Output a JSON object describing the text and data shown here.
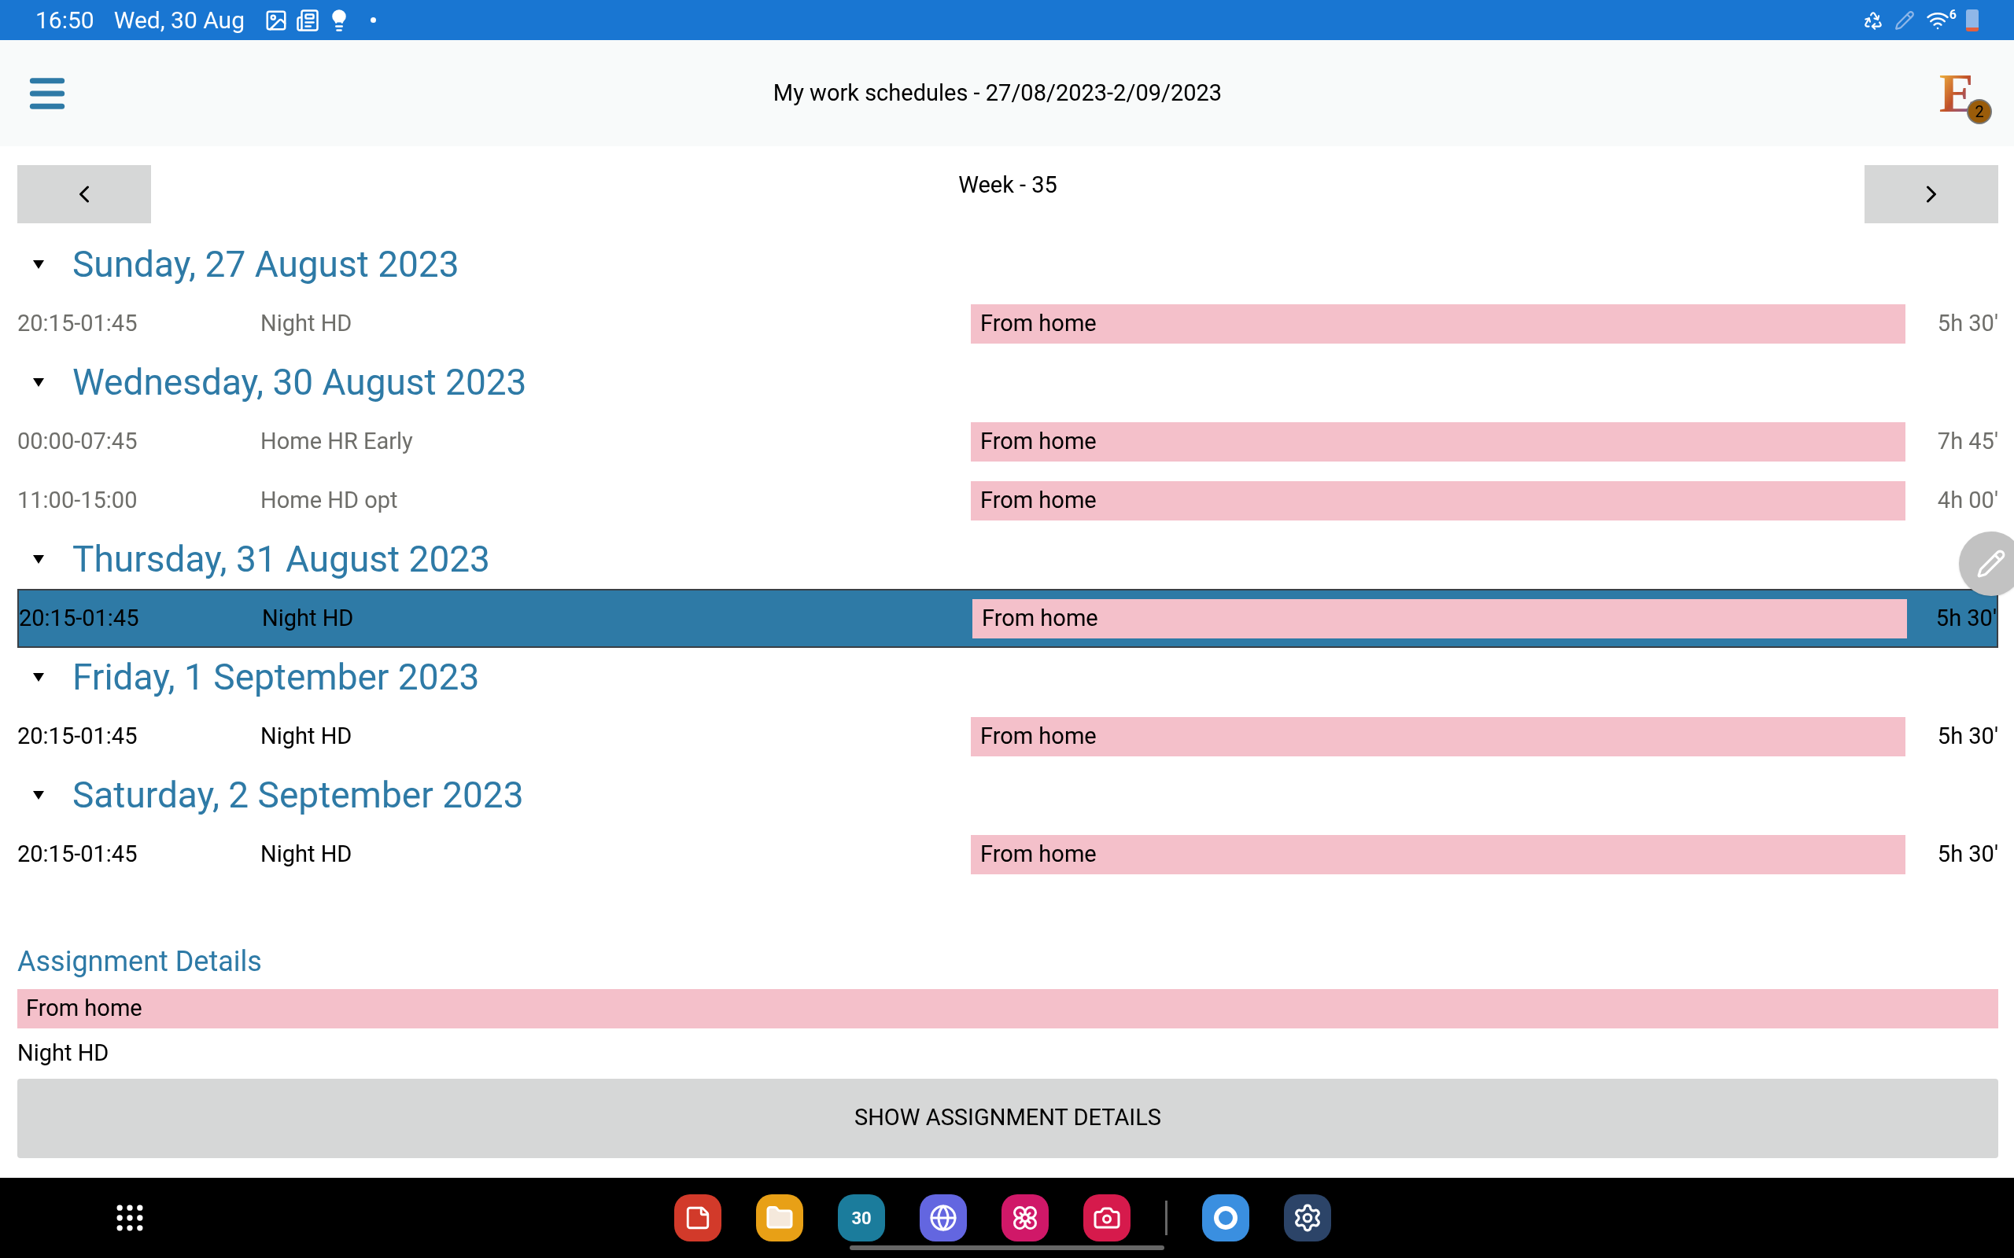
{
  "status_bar": {
    "time": "16:50",
    "date": "Wed, 30 Aug",
    "wifi_band": "6"
  },
  "header": {
    "title": "My work schedules - 27/08/2023-2/09/2023",
    "logo_letter": "E",
    "badge": "2"
  },
  "week": {
    "label": "Week - 35"
  },
  "days": [
    {
      "title": "Sunday, 27 August 2023",
      "expanded": true,
      "shifts": [
        {
          "time": "20:15-01:45",
          "name": "Night HD",
          "assignment": "From home",
          "duration": "5h 30'",
          "past": true,
          "selected": false
        }
      ]
    },
    {
      "title": "Wednesday, 30 August 2023",
      "expanded": true,
      "shifts": [
        {
          "time": "00:00-07:45",
          "name": "Home HR Early",
          "assignment": "From home",
          "duration": "7h 45'",
          "past": true,
          "selected": false
        },
        {
          "time": "11:00-15:00",
          "name": "Home HD opt",
          "assignment": "From home",
          "duration": "4h 00'",
          "past": true,
          "selected": false
        }
      ]
    },
    {
      "title": "Thursday, 31 August 2023",
      "expanded": true,
      "shifts": [
        {
          "time": "20:15-01:45",
          "name": "Night HD",
          "assignment": "From home",
          "duration": "5h 30'",
          "past": false,
          "selected": true
        }
      ]
    },
    {
      "title": "Friday, 1 September 2023",
      "expanded": true,
      "shifts": [
        {
          "time": "20:15-01:45",
          "name": "Night HD",
          "assignment": "From home",
          "duration": "5h 30'",
          "past": false,
          "selected": false
        }
      ]
    },
    {
      "title": "Saturday, 2 September 2023",
      "expanded": true,
      "shifts": [
        {
          "time": "20:15-01:45",
          "name": "Night HD",
          "assignment": "From home",
          "duration": "5h 30'",
          "past": false,
          "selected": false
        }
      ]
    }
  ],
  "details": {
    "heading": "Assignment Details",
    "assignment": "From home",
    "shift": "Night HD",
    "button": "SHOW ASSIGNMENT DETAILS"
  },
  "dock": {
    "calendar_day": "30"
  }
}
